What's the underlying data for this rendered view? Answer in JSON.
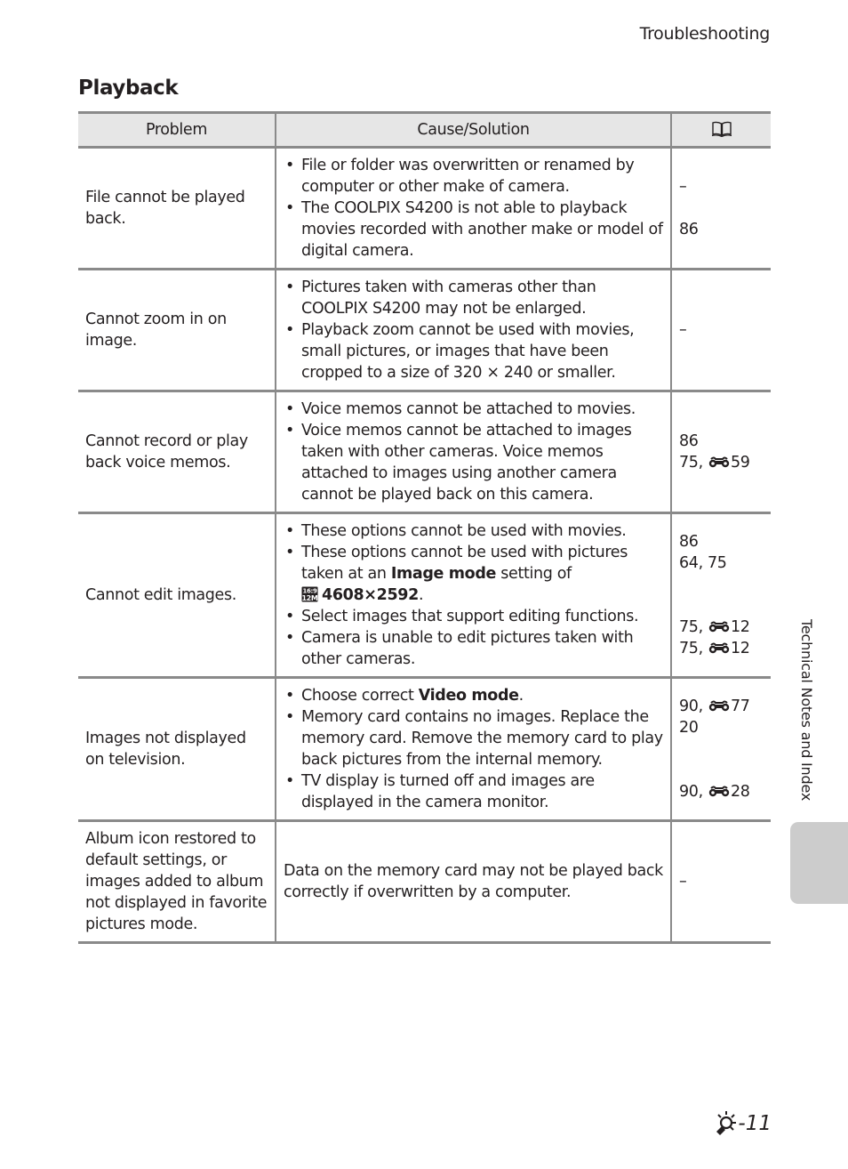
{
  "header": {
    "running_title": "Troubleshooting"
  },
  "section": {
    "title": "Playback"
  },
  "table": {
    "columns": {
      "problem": "Problem",
      "cause": "Cause/Solution",
      "ref_icon": "book-icon"
    },
    "reference_icon": "binoculars-icon",
    "rows": [
      {
        "problem": "File cannot be played back.",
        "causes": [
          "File or folder was overwritten or renamed by computer or other make of camera.",
          "The COOLPIX S4200 is not able to playback movies recorded with another make or model of digital camera."
        ],
        "refs": [
          "–",
          "86"
        ]
      },
      {
        "problem": "Cannot zoom in on image.",
        "causes": [
          "Pictures taken with cameras other than COOLPIX S4200 may not be enlarged.",
          "Playback zoom cannot be used with movies, small pictures, or images that have been cropped to a size of 320 × 240 or smaller."
        ],
        "refs": [
          "–"
        ]
      },
      {
        "problem": "Cannot record or play back voice memos.",
        "causes": [
          "Voice memos cannot be attached to movies.",
          "Voice memos cannot be attached to images taken with other cameras. Voice memos attached to images using another camera cannot be played back on this camera."
        ],
        "refs": [
          {
            "text": "86"
          },
          {
            "page": "75, ",
            "icon": "binoculars-icon",
            "ref": "59"
          }
        ]
      },
      {
        "problem": "Cannot edit images.",
        "causes": [
          {
            "text": "These options cannot be used with movies."
          },
          {
            "pre": "These options cannot be used with pictures taken at an ",
            "bold": "Image mode",
            "mid": " setting of",
            "icon": "16:9 12M image-size icon",
            "bold2": "4608×2592",
            "post": "."
          },
          {
            "text": "Select images that support editing functions."
          },
          {
            "text": "Camera is unable to edit pictures taken with other cameras."
          }
        ],
        "refs": [
          {
            "text": "86"
          },
          {
            "text": "64, 75"
          },
          {
            "page": "75, ",
            "icon": "binoculars-icon",
            "ref": "12"
          },
          {
            "page": "75, ",
            "icon": "binoculars-icon",
            "ref": "12"
          }
        ]
      },
      {
        "problem": "Images not displayed on television.",
        "causes": [
          {
            "pre": "Choose correct ",
            "bold": "Video mode",
            "post": "."
          },
          {
            "text": "Memory card contains no images. Replace the memory card. Remove the memory card to play back pictures from the internal memory."
          },
          {
            "text": "TV display is turned off and images are displayed in the camera monitor."
          }
        ],
        "refs": [
          {
            "page": "90, ",
            "icon": "binoculars-icon",
            "ref": "77"
          },
          {
            "text": "20"
          },
          {
            "page": "90, ",
            "icon": "binoculars-icon",
            "ref": "28"
          }
        ]
      },
      {
        "problem": "Album icon restored to default settings, or images added to album not displayed in favorite pictures mode.",
        "cause_plain": "Data on the memory card may not be played back correctly if overwritten by a computer.",
        "refs": [
          "–"
        ]
      }
    ]
  },
  "side_tab": {
    "label": "Technical Notes and Index"
  },
  "footer": {
    "page_icon": "lightbulb-icon",
    "page_number": "-11"
  }
}
